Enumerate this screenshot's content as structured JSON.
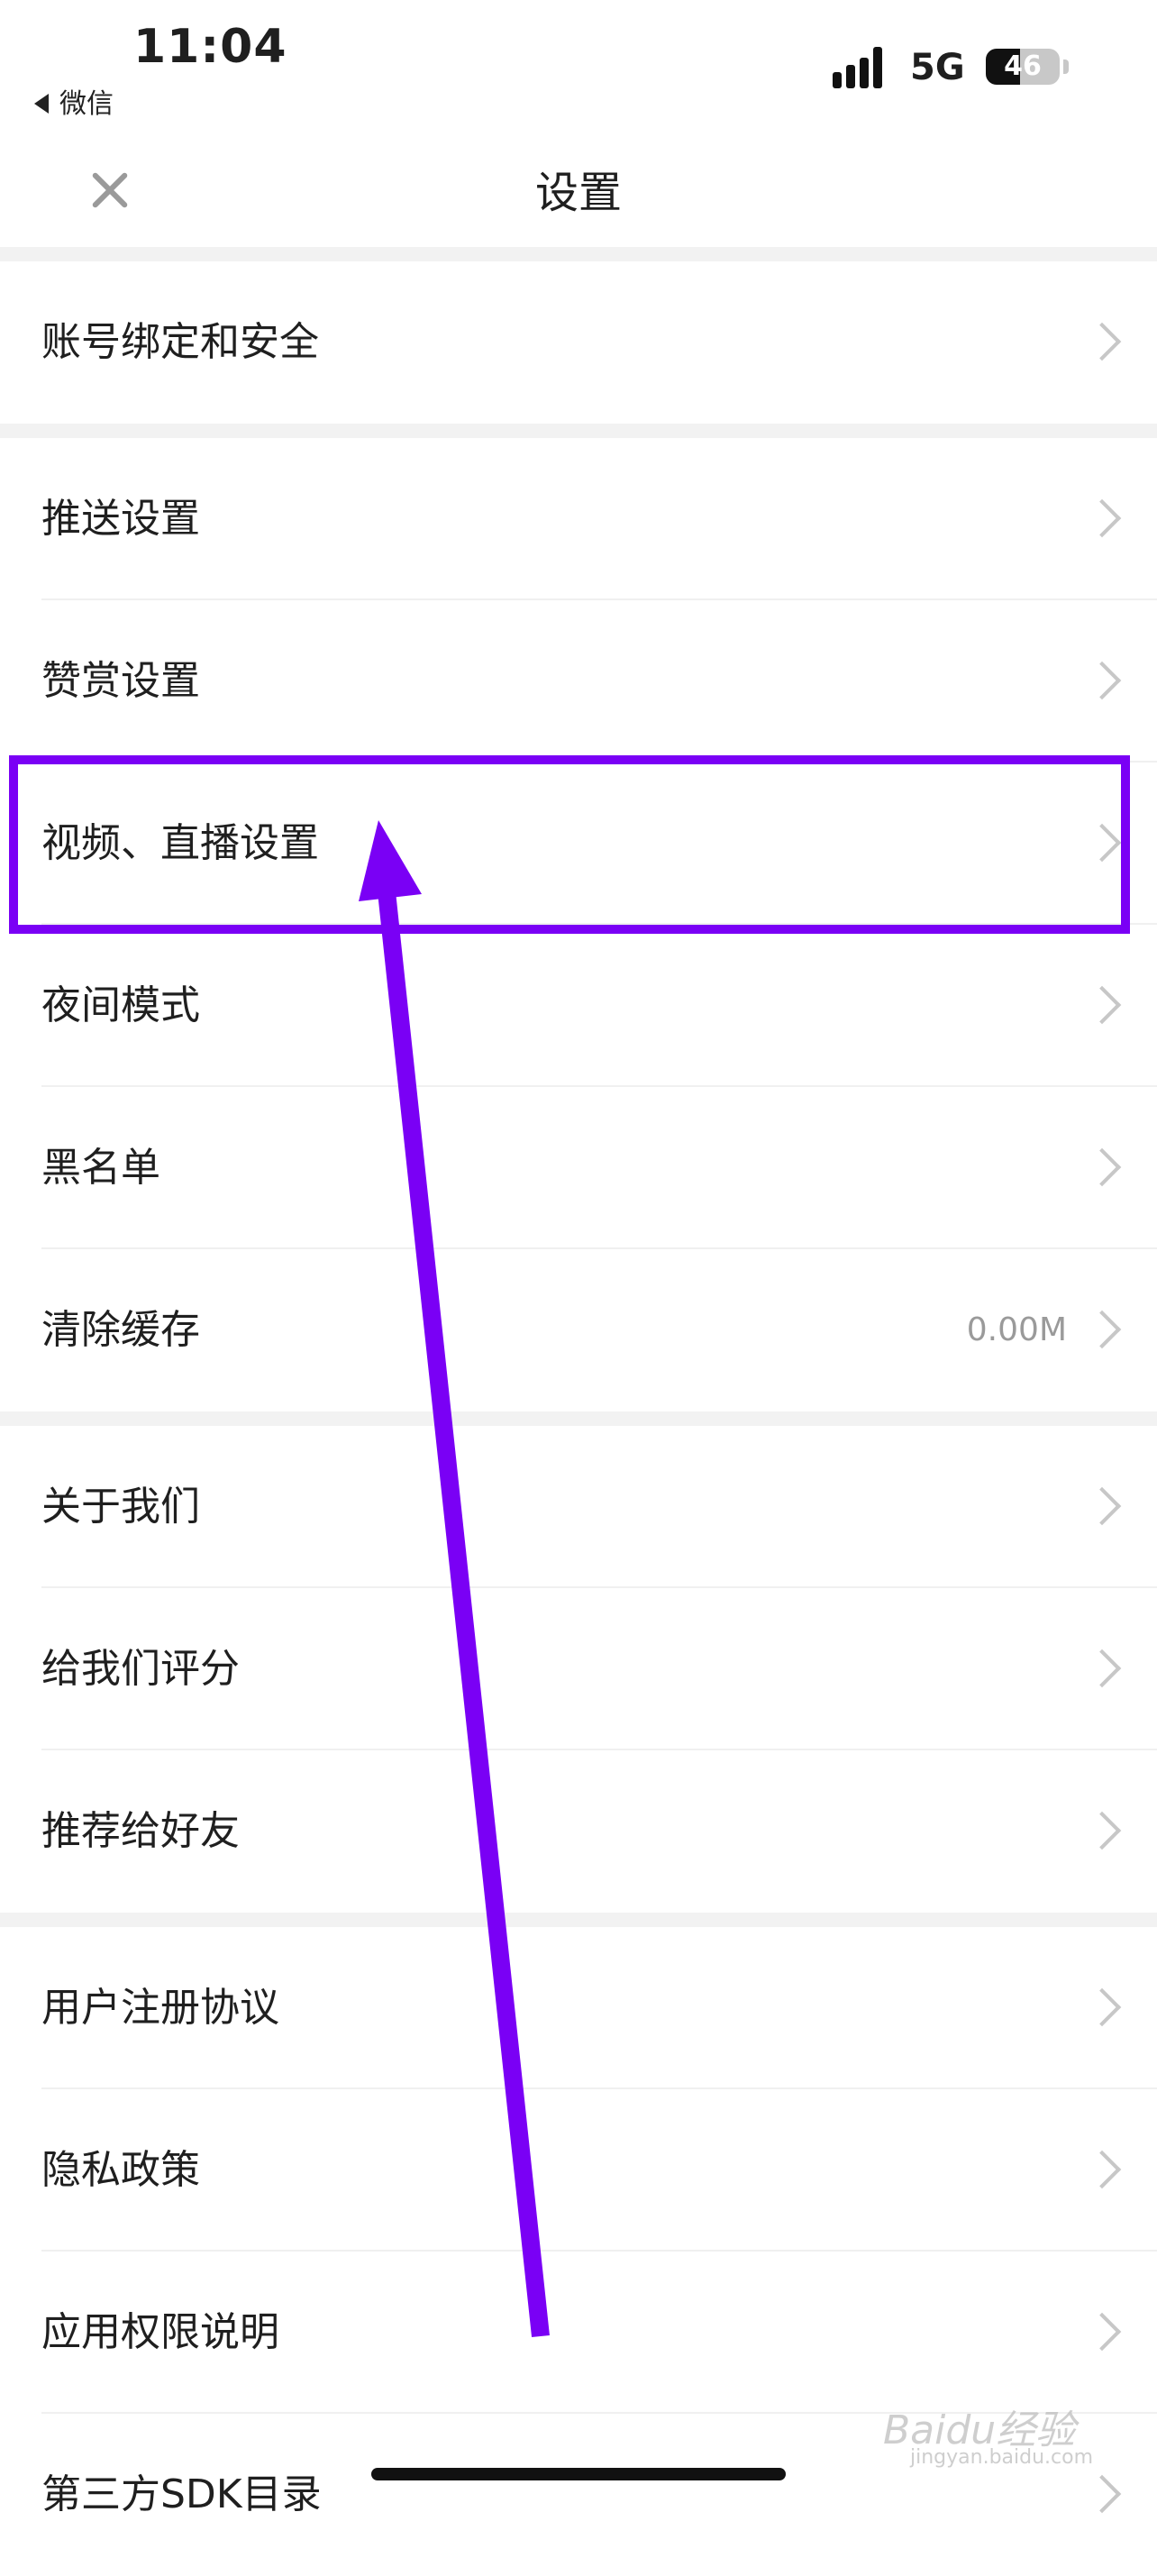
{
  "status_bar": {
    "time": "11:04",
    "back_app": "微信",
    "network": "5G",
    "battery": "46",
    "battery_level_percent": 46
  },
  "nav": {
    "title": "设置"
  },
  "settings": {
    "account_security": "账号绑定和安全",
    "push": "推送设置",
    "reward": "赞赏设置",
    "video_live": "视频、直播设置",
    "night_mode": "夜间模式",
    "blacklist": "黑名单",
    "clear_cache": "清除缓存",
    "cache_size": "0.00M",
    "about_us": "关于我们",
    "rate_us": "给我们评分",
    "recommend": "推荐给好友",
    "user_agreement": "用户注册协议",
    "privacy": "隐私政策",
    "permissions": "应用权限说明",
    "sdk_list": "第三方SDK目录"
  },
  "watermark": {
    "brand": "Baidu经验",
    "url": "jingyan.baidu.com"
  },
  "colors": {
    "highlight": "#7a00f5",
    "chevron": "#c7c7c7",
    "section_gap": "#f2f2f2"
  }
}
